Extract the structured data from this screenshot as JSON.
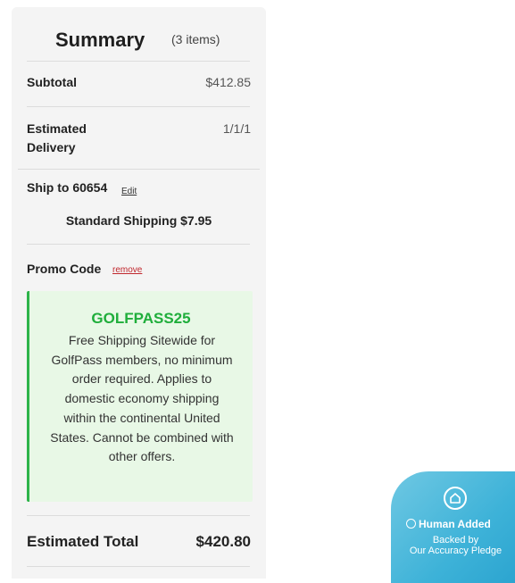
{
  "summary": {
    "title": "Summary",
    "item_count": "(3 items)",
    "subtotal_label": "Subtotal",
    "subtotal_value": "$412.85",
    "delivery_label_line1": "Estimated",
    "delivery_label_line2": "Delivery",
    "delivery_value": "1/1/1",
    "ship_to_label": "Ship to 60654",
    "edit_label": "Edit",
    "shipping_method": "Standard Shipping $7.95",
    "promo_label": "Promo Code",
    "remove_label": "remove",
    "promo": {
      "code": "GOLFPASS25",
      "description": "Free Shipping Sitewide for GolfPass members, no minimum order required. Applies to domestic economy shipping within the continental United States. Cannot be combined with other offers."
    },
    "total_label": "Estimated Total",
    "total_value": "$420.80"
  },
  "badge": {
    "icon": "home-icon",
    "title": "Human Added",
    "line1": "Backed by",
    "line2": "Our Accuracy Pledge"
  },
  "colors": {
    "panel_bg": "#f4f4f4",
    "promo_green": "#1fae3b",
    "promo_bg": "#e8f8e6",
    "remove_red": "#c0272d",
    "badge_blue": "#3db2d8"
  }
}
